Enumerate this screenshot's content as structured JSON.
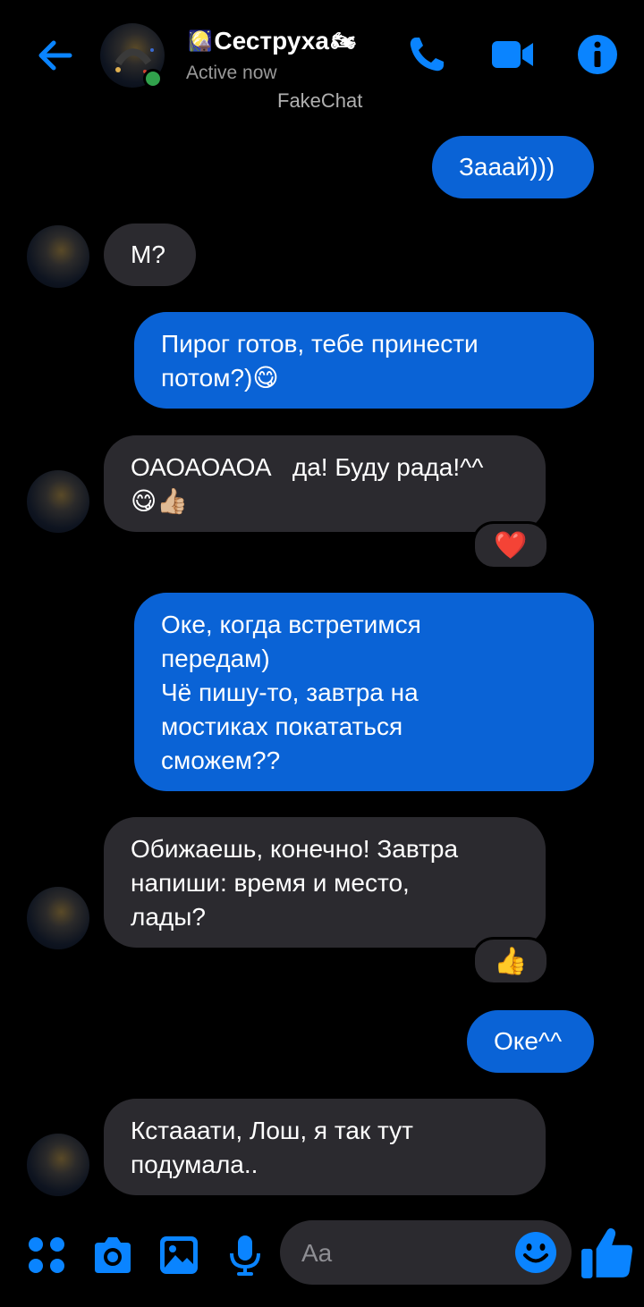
{
  "header": {
    "contact_name": "Сеструха",
    "name_prefix_emoji": "🎑",
    "name_suffix_emoji": "🏍",
    "status": "Active now",
    "watermark": "FakeChat"
  },
  "messages": [
    {
      "from": "me",
      "text": "Зааай)))"
    },
    {
      "from": "them",
      "text": "М?"
    },
    {
      "from": "me",
      "text": "Пирог готов, тебе принести\nпотом?)😋"
    },
    {
      "from": "them",
      "text": "ОАОАОАОА   да! Буду рада!^^\n😋👍🏼",
      "reaction": "❤️"
    },
    {
      "from": "me",
      "text": "Оке, когда встретимся\nпередам)\nЧё пишу-то, завтра на\nмостиках покататься\nсможем??"
    },
    {
      "from": "them",
      "text": "Обижаешь, конечно! Завтра\nнапиши: время и место,\nлады?",
      "reaction": "👍"
    },
    {
      "from": "me",
      "text": "Оке^^"
    },
    {
      "from": "them",
      "text": "Кстааати, Лош, я так тут\nподумала.."
    }
  ],
  "composer": {
    "placeholder": "Aa"
  },
  "colors": {
    "accent": "#0a84ff",
    "outgoing_bubble": "#0a63d6",
    "incoming_bubble": "#2b2a2f",
    "online": "#31a24c"
  },
  "icons": [
    "back-arrow-icon",
    "phone-icon",
    "video-icon",
    "info-icon",
    "menu-dots-icon",
    "camera-icon",
    "gallery-icon",
    "mic-icon",
    "emoji-icon",
    "thumbs-up-icon"
  ]
}
